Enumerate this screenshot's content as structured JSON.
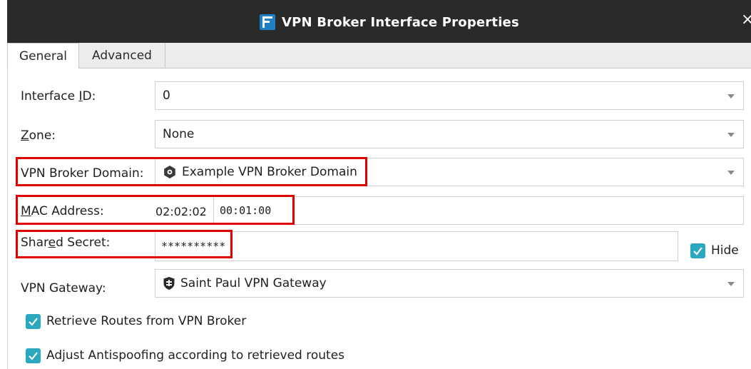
{
  "window": {
    "title": "VPN Broker Interface Properties",
    "icon": "app-logo-icon",
    "close_glyph": "×"
  },
  "tabs": [
    {
      "label": "General",
      "active": true
    },
    {
      "label": "Advanced",
      "active": false
    }
  ],
  "form": {
    "interface_id": {
      "label_pre": "Interface ",
      "label_key": "I",
      "label_post": "D:",
      "value": "0"
    },
    "zone": {
      "label_key": "Z",
      "label_post": "one:",
      "value": "None"
    },
    "vpn_broker_domain": {
      "label": "VPN Broker Domain:",
      "value": "Example VPN Broker Domain",
      "icon": "gear-domain-icon"
    },
    "mac_address": {
      "label_key": "M",
      "label_post": "AC Address:",
      "prefix": "02:02:02",
      "value": "00:01:00"
    },
    "shared_secret": {
      "label_pre": "Shar",
      "label_key": "e",
      "label_post": "d Secret:",
      "value": "**********"
    },
    "hide": {
      "label": "Hide",
      "checked": true
    },
    "vpn_gateway": {
      "label": "VPN Gateway:",
      "value": "Saint Paul VPN Gateway",
      "icon": "shield-gateway-icon"
    },
    "retrieve_routes": {
      "label": "Retrieve Routes from VPN Broker",
      "checked": true
    },
    "adjust_antispoofing": {
      "label": "Adjust Antispoofing according to retrieved routes",
      "checked": true
    }
  },
  "colors": {
    "titlebar": "#2a2a2a",
    "highlight": "#e00000",
    "checkbox": "#2aa8c0",
    "app_icon": "#1f7fc4"
  }
}
